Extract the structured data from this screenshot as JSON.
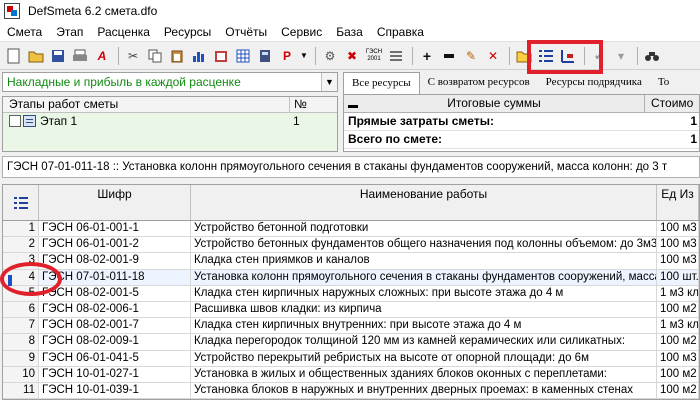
{
  "window": {
    "title": "DefSmeta 6.2   смета.dfo"
  },
  "menu": [
    "Смета",
    "Этап",
    "Расценка",
    "Ресурсы",
    "Отчёты",
    "Сервис",
    "База",
    "Справка"
  ],
  "toolbar": {
    "icons": [
      "new-doc-icon",
      "open-folder-icon",
      "save-icon",
      "print-icon",
      "font-icon",
      "cut-icon",
      "copy-icon",
      "paste-icon",
      "chart-icon",
      "book-icon",
      "grid-icon",
      "calculator-icon",
      "p-icon",
      "dropdown-icon",
      "tools-icon",
      "x-icon",
      "gesn-icon",
      "list-icon",
      "add-icon",
      "remove-icon",
      "edit-icon",
      "delete-icon",
      "folder-icon",
      "numbered-list-icon",
      "sort-icon",
      "check-icon",
      "filter-icon",
      "binoculars-icon"
    ],
    "gesn_label": "ГЭСН 2001"
  },
  "overheads_select": {
    "value": "Накладные и прибыль в каждой расценке"
  },
  "stages": {
    "header": {
      "name": "Этапы работ сметы",
      "num": "№"
    },
    "rows": [
      {
        "name": "Этап 1",
        "num": "1"
      }
    ]
  },
  "resource_tabs": [
    "Все ресурсы",
    "С возвратом ресурсов",
    "Ресурсы подрядчика",
    "То"
  ],
  "totals": {
    "header": {
      "name": "Итоговые суммы",
      "value": "Стоимо"
    },
    "rows": [
      {
        "name": "Прямые затраты сметы:",
        "value": "1"
      },
      {
        "name": "Всего по смете:",
        "value": "1"
      }
    ]
  },
  "info_line": "ГЭСН 07-01-011-18  ::  Установка колонн прямоугольного сечения в стаканы фундаментов сооружений, масса колонн: до 3 т",
  "table": {
    "headers": {
      "code": "Шифр",
      "name": "Наименование работы",
      "unit": "Ед Из"
    },
    "rows": [
      {
        "num": "1",
        "code": "ГЭСН 06-01-001-1",
        "name": "Устройство бетонной подготовки",
        "unit": "100 м3"
      },
      {
        "num": "2",
        "code": "ГЭСН 06-01-001-2",
        "name": "Устройство бетонных фундаментов общего назначения под колонны объемом: до 3м3",
        "unit": "100 м3"
      },
      {
        "num": "3",
        "code": "ГЭСН 08-02-001-9",
        "name": "Кладка стен приямков и каналов",
        "unit": "100 м3"
      },
      {
        "num": "4",
        "code": "ГЭСН 07-01-011-18",
        "name": "Установка колонн прямоугольного сечения в стаканы фундаментов сооружений, масса",
        "unit": "100 шт."
      },
      {
        "num": "5",
        "code": "ГЭСН 08-02-001-5",
        "name": "Кладка стен кирпичных наружных сложных: при высоте этажа до 4 м",
        "unit": "1 м3 кла"
      },
      {
        "num": "6",
        "code": "ГЭСН 08-02-006-1",
        "name": "Расшивка швов кладки: из кирпича",
        "unit": "100 м2 с"
      },
      {
        "num": "7",
        "code": "ГЭСН 08-02-001-7",
        "name": "Кладка стен кирпичных внутренних: при высоте этажа до 4 м",
        "unit": "1 м3 кла"
      },
      {
        "num": "8",
        "code": "ГЭСН 08-02-009-1",
        "name": "Кладка перегородок толщиной 120 мм из камней керамических или силикатных:",
        "unit": "100 м2"
      },
      {
        "num": "9",
        "code": "ГЭСН 06-01-041-5",
        "name": "Устройство перекрытий ребристых на высоте от опорной площади: до 6м",
        "unit": "100 м3"
      },
      {
        "num": "10",
        "code": "ГЭСН 10-01-027-1",
        "name": "Установка в жилых и общественных зданиях блоков оконных с переплетами:",
        "unit": "100 м2"
      },
      {
        "num": "11",
        "code": "ГЭСН 10-01-039-1",
        "name": "Установка блоков в наружных и внутренних дверных проемах: в каменных стенах",
        "unit": "100 м2"
      }
    ]
  },
  "colors": {
    "annotation": "#e0202a",
    "green_text": "#108a10",
    "stage_bg": "#eaf7e6"
  }
}
